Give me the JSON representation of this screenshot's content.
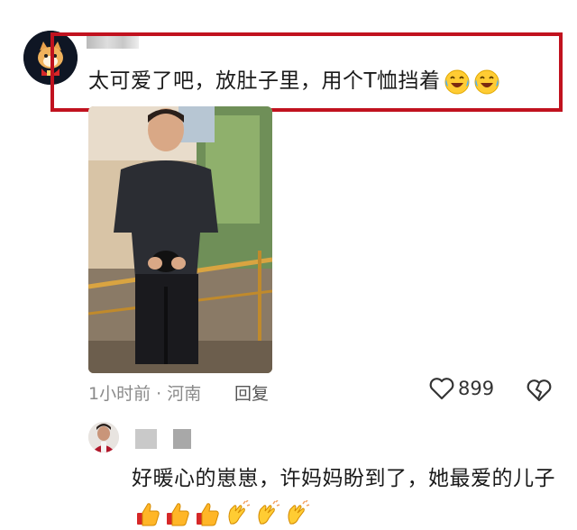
{
  "comment1": {
    "avatar_icon": "cartoon-cat-avatar-icon",
    "text": "太可爱了吧，放肚子里，用个T恤挡着",
    "emojis": [
      "laughing-tears-emoji",
      "laughing-tears-emoji"
    ],
    "highlight_color": "#c1121f"
  },
  "meta": {
    "time_location": "1小时前 · 河南",
    "reply_label": "回复",
    "like_count": "899",
    "like_icon": "heart-outline-icon",
    "dislike_icon": "broken-heart-icon"
  },
  "comment2": {
    "avatar_icon": "user-photo-avatar",
    "text": "好暖心的崽崽，许妈妈盼到了，她最爱的儿子",
    "emojis": [
      "thumbs-up-emoji",
      "thumbs-up-emoji",
      "thumbs-up-emoji",
      "clapping-hands-emoji",
      "clapping-hands-emoji",
      "clapping-hands-emoji"
    ]
  }
}
